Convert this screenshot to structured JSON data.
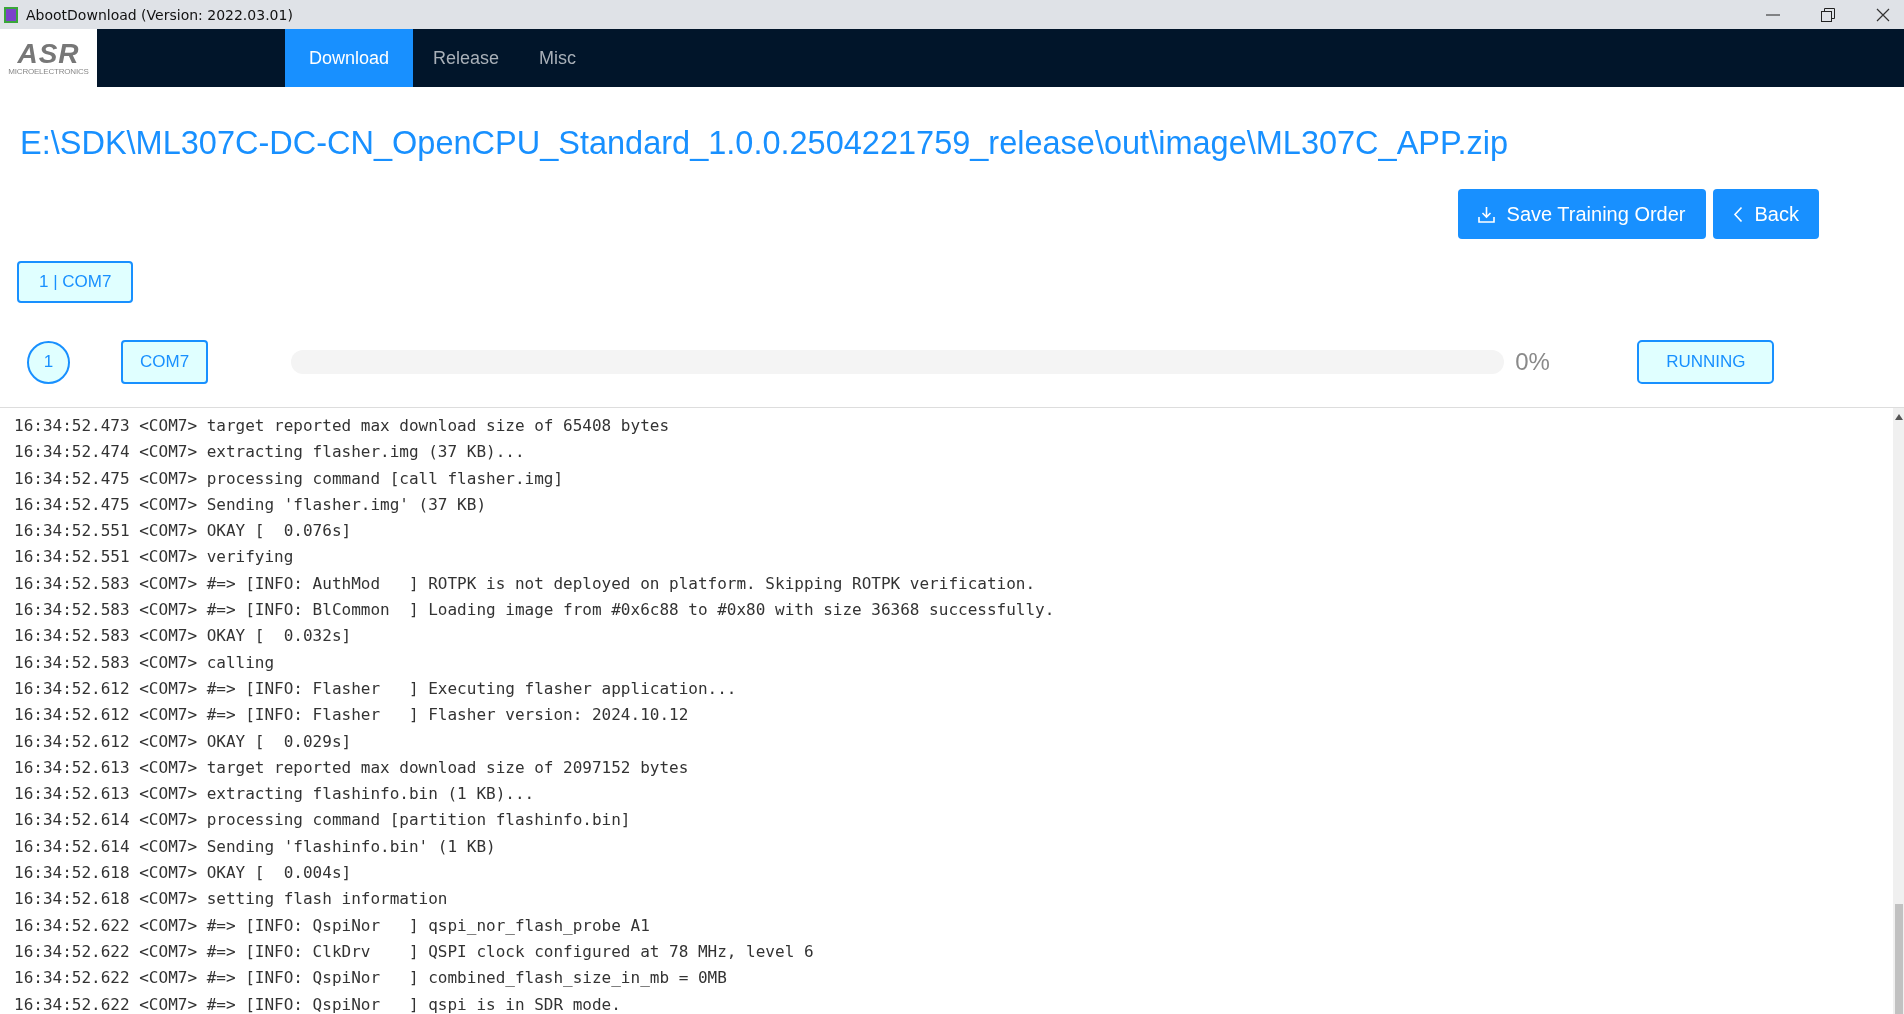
{
  "window": {
    "title": "AbootDownload (Version: 2022.03.01)"
  },
  "logo": {
    "text": "ASR",
    "subtext": "MICROELECTRONICS"
  },
  "tabs": [
    {
      "label": "Download",
      "selected": true
    },
    {
      "label": "Release",
      "selected": false
    },
    {
      "label": "Misc",
      "selected": false
    }
  ],
  "file_path": "E:\\SDK\\ML307C-DC-CN_OpenCPU_Standard_1.0.0.2504221759_release\\out\\image\\ML307C_APP.zip",
  "buttons": [
    {
      "kind": "download",
      "label": "Save Training Order"
    },
    {
      "kind": "back",
      "label": "Back"
    }
  ],
  "port_tags": [
    "1 | COM7"
  ],
  "devices": [
    {
      "index": "1",
      "port": "COM7",
      "level": 0,
      "percent": "0%",
      "status": "RUNNING"
    }
  ],
  "log": [
    "16:34:52.473 <COM7> target reported max download size of 65408 bytes",
    "16:34:52.474 <COM7> extracting flasher.img (37 KB)...",
    "16:34:52.475 <COM7> processing command [call flasher.img]",
    "16:34:52.475 <COM7> Sending 'flasher.img' (37 KB)",
    "16:34:52.551 <COM7> OKAY [  0.076s]",
    "16:34:52.551 <COM7> verifying",
    "16:34:52.583 <COM7> #=> [INFO: AuthMod   ] ROTPK is not deployed on platform. Skipping ROTPK verification.",
    "16:34:52.583 <COM7> #=> [INFO: BlCommon  ] Loading image from #0x6c88 to #0x80 with size 36368 successfully.",
    "16:34:52.583 <COM7> OKAY [  0.032s]",
    "16:34:52.583 <COM7> calling",
    "16:34:52.612 <COM7> #=> [INFO: Flasher   ] Executing flasher application...",
    "16:34:52.612 <COM7> #=> [INFO: Flasher   ] Flasher version: 2024.10.12",
    "16:34:52.612 <COM7> OKAY [  0.029s]",
    "16:34:52.613 <COM7> target reported max download size of 2097152 bytes",
    "16:34:52.613 <COM7> extracting flashinfo.bin (1 KB)...",
    "16:34:52.614 <COM7> processing command [partition flashinfo.bin]",
    "16:34:52.614 <COM7> Sending 'flashinfo.bin' (1 KB)",
    "16:34:52.618 <COM7> OKAY [  0.004s]",
    "16:34:52.618 <COM7> setting flash information",
    "16:34:52.622 <COM7> #=> [INFO: QspiNor   ] qspi_nor_flash_probe A1",
    "16:34:52.622 <COM7> #=> [INFO: ClkDrv    ] QSPI clock configured at 78 MHz, level 6",
    "16:34:52.622 <COM7> #=> [INFO: QspiNor   ] combined_flash_size_in_mb = 0MB",
    "16:34:52.622 <COM7> #=> [INFO: QspiNor   ] qspi is in SDR mode."
  ]
}
